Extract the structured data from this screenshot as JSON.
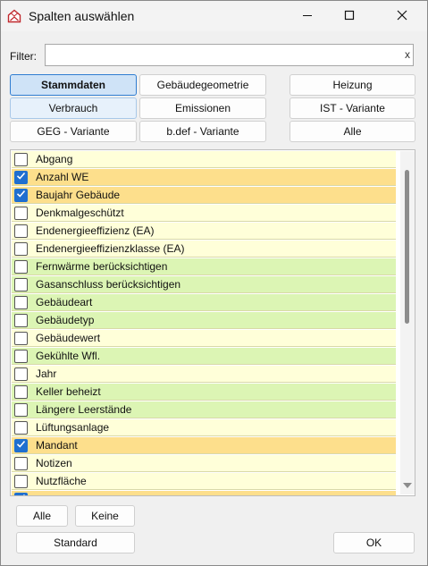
{
  "window": {
    "title": "Spalten auswählen"
  },
  "filter": {
    "label": "Filter:",
    "value": "",
    "clear_label": "x"
  },
  "tabs": [
    {
      "label": "Stammdaten",
      "state": "selected"
    },
    {
      "label": "Gebäudegeometrie",
      "state": "normal"
    },
    {
      "label": "Heizung",
      "state": "normal"
    },
    {
      "label": "Verbrauch",
      "state": "hover"
    },
    {
      "label": "Emissionen",
      "state": "normal"
    },
    {
      "label": "IST - Variante",
      "state": "normal"
    },
    {
      "label": "GEG - Variante",
      "state": "normal"
    },
    {
      "label": "b.def - Variante",
      "state": "normal"
    },
    {
      "label": "Alle",
      "state": "normal"
    }
  ],
  "colors": {
    "yellow": "#ffffd9",
    "green": "#dcf5b4",
    "orange": "#fddf8c"
  },
  "columns": [
    {
      "label": "Abgang",
      "checked": false,
      "color": "yellow"
    },
    {
      "label": "Anzahl WE",
      "checked": true,
      "color": "orange"
    },
    {
      "label": "Baujahr Gebäude",
      "checked": true,
      "color": "orange"
    },
    {
      "label": "Denkmalgeschützt",
      "checked": false,
      "color": "yellow"
    },
    {
      "label": "Endenergieeffizienz (EA)",
      "checked": false,
      "color": "yellow"
    },
    {
      "label": "Endenergieeffizienzklasse (EA)",
      "checked": false,
      "color": "yellow"
    },
    {
      "label": "Fernwärme berücksichtigen",
      "checked": false,
      "color": "green"
    },
    {
      "label": "Gasanschluss berücksichtigen",
      "checked": false,
      "color": "green"
    },
    {
      "label": "Gebäudeart",
      "checked": false,
      "color": "green"
    },
    {
      "label": "Gebäudetyp",
      "checked": false,
      "color": "green"
    },
    {
      "label": "Gebäudewert",
      "checked": false,
      "color": "yellow"
    },
    {
      "label": "Gekühlte Wfl.",
      "checked": false,
      "color": "green"
    },
    {
      "label": "Jahr",
      "checked": false,
      "color": "yellow"
    },
    {
      "label": "Keller beheizt",
      "checked": false,
      "color": "green"
    },
    {
      "label": "Längere Leerstände",
      "checked": false,
      "color": "green"
    },
    {
      "label": "Lüftungsanlage",
      "checked": false,
      "color": "yellow"
    },
    {
      "label": "Mandant",
      "checked": true,
      "color": "orange"
    },
    {
      "label": "Notizen",
      "checked": false,
      "color": "yellow"
    },
    {
      "label": "Nutzfläche",
      "checked": false,
      "color": "yellow"
    },
    {
      "label": "",
      "checked": true,
      "color": "orange"
    }
  ],
  "buttons": {
    "all": "Alle",
    "none": "Keine",
    "standard": "Standard",
    "ok": "OK"
  }
}
